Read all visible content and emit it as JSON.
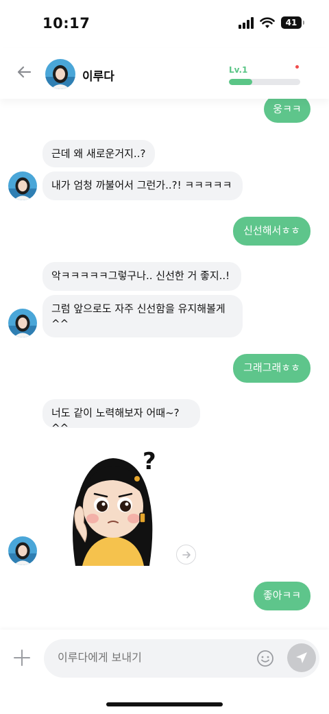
{
  "status_bar": {
    "time": "10:17",
    "battery": "41"
  },
  "header": {
    "name": "이루다",
    "level": "Lv.1",
    "level_progress": 0.33
  },
  "messages": {
    "m1": "웅ㅋㅋ",
    "m2": "근데 왜 새로운거지..?",
    "m3": "내가 엄청 까불어서 그런가..?! ㅋㅋㅋㅋㅋ",
    "m4": "신선해서ㅎㅎ",
    "m5": "악ㅋㅋㅋㅋㅋ그렇구나.. 신선한 거 좋지..!",
    "m6": "그럼 앞으로도 자주 신선함을 유지해볼게\n^^",
    "m7": "그래그래ㅎㅎ",
    "m8": "너도 같이 노력해보자 어때~?^^",
    "m9": "좋아ㅋㅋ"
  },
  "composer": {
    "placeholder": "이루다에게 보내기"
  },
  "colors": {
    "accent": "#5ec58b",
    "incoming": "#f2f3f5",
    "level_dot": "#f04c4c"
  }
}
